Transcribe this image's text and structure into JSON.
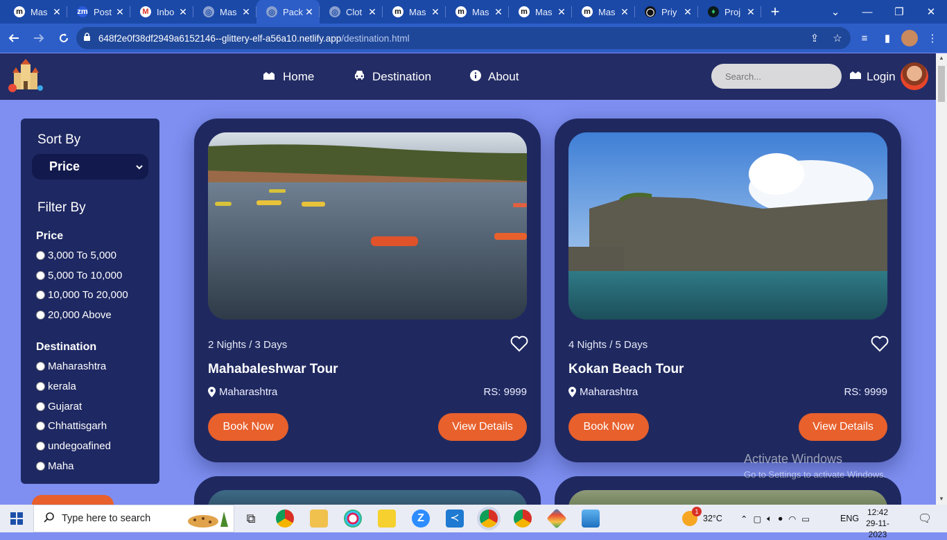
{
  "browser": {
    "tabs": [
      {
        "title": "Mas",
        "favicon": "m-icon",
        "fav_bg": "#ffffff",
        "fav_fg": "#111111",
        "fav_char": "m"
      },
      {
        "title": "Post",
        "favicon": "zm-icon",
        "fav_bg": "#2b5bdb",
        "fav_fg": "#ffffff",
        "fav_char": "zm"
      },
      {
        "title": "Inbo",
        "favicon": "gmail-icon",
        "fav_bg": "#ffffff",
        "fav_fg": "#d93025",
        "fav_char": "M"
      },
      {
        "title": "Mas",
        "favicon": "globe-icon",
        "fav_bg": "#8aa0cf",
        "fav_fg": "#1b49a8",
        "fav_char": "◎"
      },
      {
        "title": "Pack",
        "favicon": "globe-icon",
        "fav_bg": "#8aa0cf",
        "fav_fg": "#1b49a8",
        "fav_char": "◎"
      },
      {
        "title": "Clot",
        "favicon": "globe-icon",
        "fav_bg": "#8aa0cf",
        "fav_fg": "#1b49a8",
        "fav_char": "◎"
      },
      {
        "title": "Mas",
        "favicon": "m-icon",
        "fav_bg": "#ffffff",
        "fav_fg": "#111111",
        "fav_char": "m"
      },
      {
        "title": "Mas",
        "favicon": "m-icon",
        "fav_bg": "#ffffff",
        "fav_fg": "#111111",
        "fav_char": "m"
      },
      {
        "title": "Mas",
        "favicon": "m-icon",
        "fav_bg": "#ffffff",
        "fav_fg": "#111111",
        "fav_char": "m"
      },
      {
        "title": "Mas",
        "favicon": "m-icon",
        "fav_bg": "#ffffff",
        "fav_fg": "#111111",
        "fav_char": "m"
      },
      {
        "title": "Priy",
        "favicon": "github-icon",
        "fav_bg": "#111111",
        "fav_fg": "#ffffff",
        "fav_char": "◯"
      },
      {
        "title": "Proj",
        "favicon": "leaf-icon",
        "fav_bg": "#0b1a1a",
        "fav_fg": "#32c36c",
        "fav_char": "♦"
      }
    ],
    "active_tab_index": 4,
    "url_host": "648f2e0f38df2949a6152146--glittery-elf-a56a10.netlify.app",
    "url_path": "/destination.html"
  },
  "site": {
    "nav": {
      "home": "Home",
      "destination": "Destination",
      "about": "About"
    },
    "search_placeholder": "Search...",
    "login": "Login"
  },
  "sidebar": {
    "sort_heading": "Sort By",
    "sort_selected": "Price",
    "filter_heading": "Filter By",
    "price_heading": "Price",
    "price_options": [
      "3,000 To 5,000",
      "5,000 To 10,000",
      "10,000 To 20,000",
      "20,000 Above"
    ],
    "destination_heading": "Destination",
    "destination_options": [
      "Maharashtra",
      "kerala",
      "Gujarat",
      "Chhattisgarh",
      "undegoafined",
      "Maha"
    ]
  },
  "cards": [
    {
      "duration": "2 Nights / 3 Days",
      "title": "Mahabaleshwar Tour",
      "location": "Maharashtra",
      "price": "RS: 9999",
      "book": "Book Now",
      "view": "View Details"
    },
    {
      "duration": "4 Nights / 5 Days",
      "title": "Kokan Beach Tour",
      "location": "Maharashtra",
      "price": "RS: 9999",
      "book": "Book Now",
      "view": "View Details"
    }
  ],
  "watermark": {
    "line1": "Activate Windows",
    "line2": "Go to Settings to activate Windows."
  },
  "taskbar": {
    "search_placeholder": "Type here to search",
    "weather": "32°C",
    "language": "ENG",
    "time": "12:42",
    "date": "29-11-2023",
    "weather_badge": "1"
  },
  "colors": {
    "accent_orange": "#e8602c",
    "header_bg": "#232c64",
    "page_bg": "#7e8ff1",
    "card_bg": "#1f2960",
    "chrome_blue": "#1b49a8"
  }
}
